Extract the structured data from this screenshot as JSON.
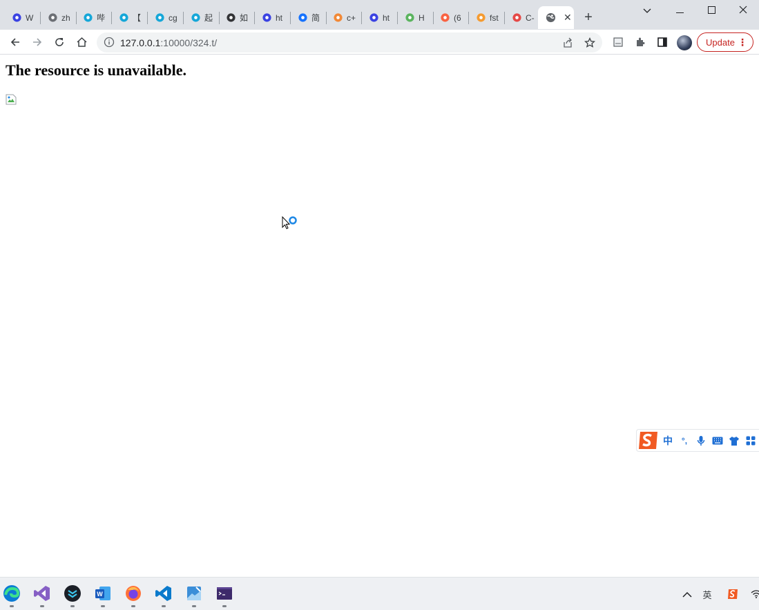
{
  "browser": {
    "tabs": [
      {
        "title": "W",
        "icon": "baidu-paw-icon",
        "color": "#2932e1"
      },
      {
        "title": "zh",
        "icon": "globe-icon",
        "color": "#5f6368"
      },
      {
        "title": "哔",
        "icon": "bilibili-icon",
        "color": "#00a1d6"
      },
      {
        "title": "【",
        "icon": "bilibili-icon",
        "color": "#00a1d6"
      },
      {
        "title": "cg",
        "icon": "bilibili-icon",
        "color": "#00a1d6"
      },
      {
        "title": "起",
        "icon": "bilibili-icon",
        "color": "#00a1d6"
      },
      {
        "title": "如",
        "icon": "mdn-icon",
        "color": "#202124"
      },
      {
        "title": "ht",
        "icon": "baidu-paw-icon",
        "color": "#2932e1"
      },
      {
        "title": "简",
        "icon": "zhihu-icon",
        "color": "#0066ff"
      },
      {
        "title": "c+",
        "icon": "stackoverflow-icon",
        "color": "#f48024"
      },
      {
        "title": "ht",
        "icon": "baidu-paw-icon",
        "color": "#2932e1"
      },
      {
        "title": "H",
        "icon": "html-icon",
        "color": "#4caf50"
      },
      {
        "title": "(6",
        "icon": "csdn-icon",
        "color": "#fc5531"
      },
      {
        "title": "fst",
        "icon": "w3cschool-icon",
        "color": "#f7941d"
      },
      {
        "title": "C-",
        "icon": "swirl-icon",
        "color": "#e53935"
      }
    ],
    "active_tab": {
      "title": "",
      "icon": "globe-icon",
      "close": "✕"
    },
    "new_tab": "+",
    "window_controls": {
      "dropdown": "⌄",
      "minimize": "—",
      "maximize": "☐",
      "close": "✕"
    },
    "url": {
      "host": "127.0.0.1",
      "path": ":10000/324.t/"
    },
    "update_label": "Update",
    "update_menu": "⋮"
  },
  "page": {
    "heading": "The resource is unavailable."
  },
  "ime": {
    "items": [
      "中",
      "°,",
      "🎤",
      "⌨",
      "👕",
      "▦"
    ]
  },
  "taskbar": {
    "apps": [
      "edge-icon",
      "visual-studio-icon",
      "typora-icon",
      "word-icon",
      "firefox-icon",
      "vscode-icon",
      "paint-icon",
      "terminal-icon"
    ],
    "tray": [
      "^",
      "英",
      "S"
    ]
  },
  "colors": {
    "accent_update": "#c5221f",
    "tab_strip": "#dee1e6",
    "omnibox": "#f1f3f4"
  }
}
